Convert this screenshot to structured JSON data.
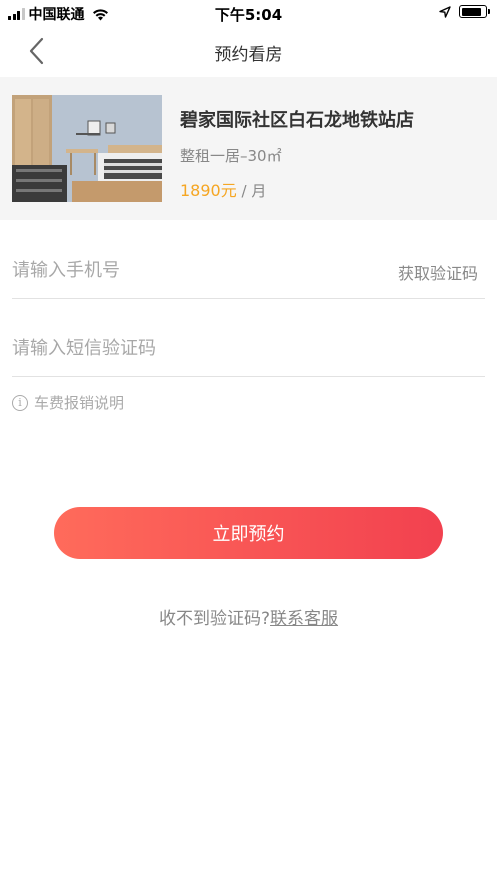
{
  "status_bar": {
    "carrier": "中国联通",
    "time": "下午5:04"
  },
  "nav": {
    "title": "预约看房"
  },
  "listing": {
    "title": "碧家国际社区白石龙地铁站店",
    "subtitle": "整租一居–30㎡",
    "price": "1890元",
    "price_unit": " / 月"
  },
  "form": {
    "phone_placeholder": "请输入手机号",
    "get_code_label": "获取验证码",
    "sms_placeholder": "请输入短信验证码",
    "note_label": "车费报销说明",
    "submit_label": "立即预约"
  },
  "help": {
    "text": "收不到验证码?",
    "link_label": "联系客服"
  },
  "colors": {
    "accent_gradient_start": "#ff6b5b",
    "accent_gradient_end": "#f2414f",
    "price": "#f5a623"
  }
}
